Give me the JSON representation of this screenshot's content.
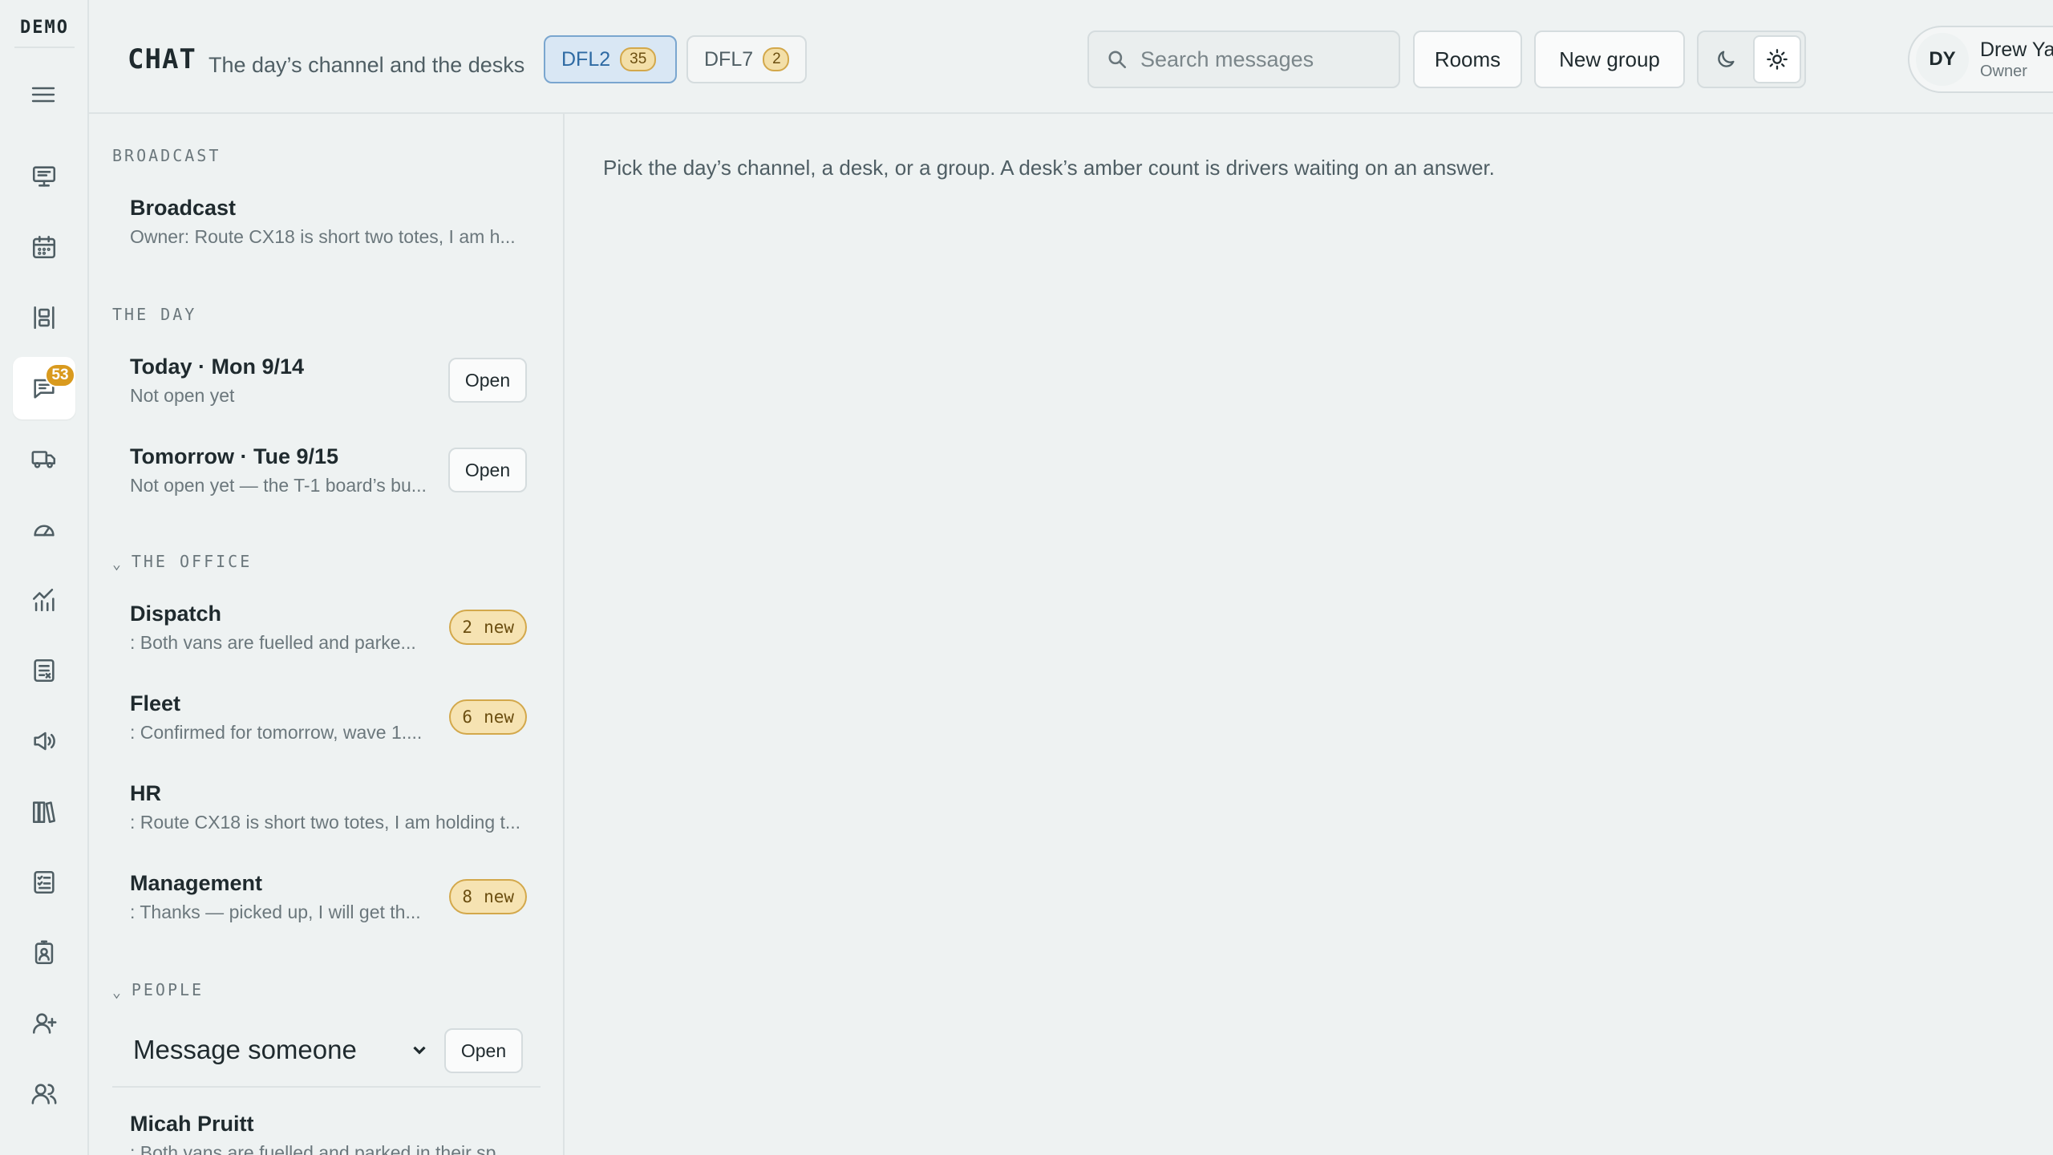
{
  "app": {
    "logo": "DEMO"
  },
  "rail": {
    "items": [
      {
        "icon": "presentation-icon"
      },
      {
        "icon": "calendar-icon"
      },
      {
        "icon": "board-icon"
      },
      {
        "icon": "chat-icon",
        "badge": "53",
        "active": true
      },
      {
        "icon": "truck-icon"
      },
      {
        "icon": "gauge-icon"
      },
      {
        "icon": "chart-icon"
      },
      {
        "icon": "document-icon"
      },
      {
        "icon": "megaphone-icon"
      },
      {
        "icon": "library-icon"
      },
      {
        "icon": "checklist-icon"
      },
      {
        "icon": "badge-icon"
      },
      {
        "icon": "user-add-icon"
      },
      {
        "icon": "users-icon"
      }
    ]
  },
  "header": {
    "title": "CHAT",
    "subtitle": "The day’s channel and the desks",
    "sites": [
      {
        "label": "DFL2",
        "count": "35",
        "active": true
      },
      {
        "label": "DFL7",
        "count": "2",
        "active": false
      }
    ],
    "search_placeholder": "Search messages",
    "rooms_label": "Rooms",
    "new_group_label": "New group",
    "theme": "light",
    "user": {
      "initials": "DY",
      "name": "Drew Yates",
      "role": "Owner"
    }
  },
  "channels": {
    "broadcast_section": "BROADCAST",
    "broadcast": {
      "name": "Broadcast",
      "preview": "Owner: Route CX18 is short two totes, I am h..."
    },
    "day_section": "THE DAY",
    "days": [
      {
        "name": "Today · Mon 9/14",
        "preview": "Not open yet",
        "action": "Open"
      },
      {
        "name": "Tomorrow · Tue 9/15",
        "preview": "Not open yet — the T-1 board’s bu...",
        "action": "Open"
      }
    ],
    "office_section": "THE OFFICE",
    "desks": [
      {
        "name": "Dispatch",
        "preview": ": Both vans are fuelled and parke...",
        "count": "2",
        "badge_word": "new"
      },
      {
        "name": "Fleet",
        "preview": ": Confirmed for tomorrow, wave 1....",
        "count": "6",
        "badge_word": "new"
      },
      {
        "name": "HR",
        "preview": ": Route CX18 is short two totes, I am holding t..."
      },
      {
        "name": "Management",
        "preview": ": Thanks — picked up, I will get th...",
        "count": "8",
        "badge_word": "new"
      }
    ],
    "people_section": "PEOPLE",
    "people_select_value": "Message someone",
    "people_open_label": "Open",
    "people": [
      {
        "name": "Micah Pruitt",
        "preview": ": Both vans are fuelled and parked in their sp..."
      }
    ]
  },
  "main": {
    "hint": "Pick the day’s channel, a desk, or a group. A desk’s amber count is drivers waiting on an answer."
  },
  "colors": {
    "accent_amber": "#d99a1e",
    "active_tab_blue": "#2e6aa3",
    "background": "#eef2f2"
  }
}
